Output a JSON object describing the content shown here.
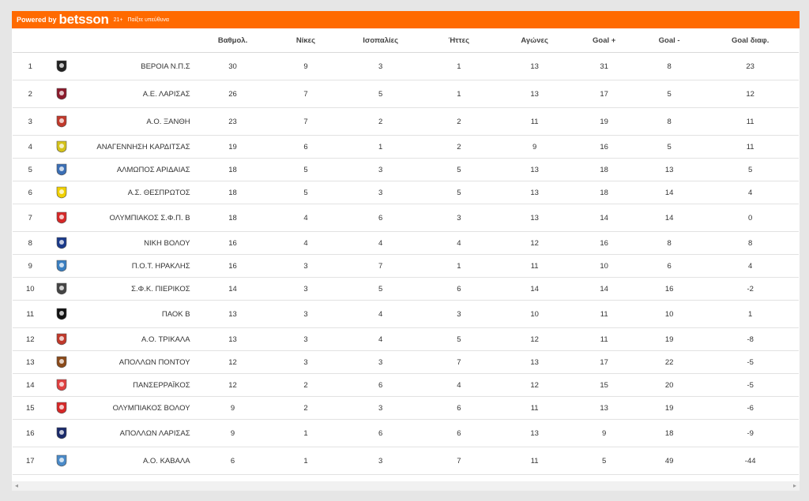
{
  "header": {
    "powered_by": "Powered by",
    "brand": "betsson",
    "age": "21+",
    "responsible": "Παίξτε υπεύθυνα"
  },
  "columns": [
    "Βαθμολ.",
    "Νίκες",
    "Ισοπαλίες",
    "Ήττες",
    "Αγώνες",
    "Goal +",
    "Goal -",
    "Goal διαφ."
  ],
  "rows": [
    {
      "pos": "1",
      "team": "ΒΕΡΟΙΑ Ν.Π.Σ",
      "pts": "30",
      "w": "9",
      "d": "3",
      "l": "1",
      "gp": "13",
      "gf": "31",
      "ga": "8",
      "gd": "23",
      "crest": "#222222",
      "tall": true
    },
    {
      "pos": "2",
      "team": "Α.Ε. ΛΑΡΙΣΑΣ",
      "pts": "26",
      "w": "7",
      "d": "5",
      "l": "1",
      "gp": "13",
      "gf": "17",
      "ga": "5",
      "gd": "12",
      "crest": "#8b1a2b",
      "tall": true
    },
    {
      "pos": "3",
      "team": "Α.Ο. ΞΑΝΘΗ",
      "pts": "23",
      "w": "7",
      "d": "2",
      "l": "2",
      "gp": "11",
      "gf": "19",
      "ga": "8",
      "gd": "11",
      "crest": "#c0392b",
      "tall": true
    },
    {
      "pos": "4",
      "team": "ΑΝΑΓΕΝΝΗΣΗ ΚΑΡΔΙΤΣΑΣ",
      "pts": "19",
      "w": "6",
      "d": "1",
      "l": "2",
      "gp": "9",
      "gf": "16",
      "ga": "5",
      "gd": "11",
      "crest": "#d4c21a",
      "tall": false
    },
    {
      "pos": "5",
      "team": "ΑΛΜΩΠΟΣ ΑΡΙΔΑΙΑΣ",
      "pts": "18",
      "w": "5",
      "d": "3",
      "l": "5",
      "gp": "13",
      "gf": "18",
      "ga": "13",
      "gd": "5",
      "crest": "#3b6fb5",
      "tall": false
    },
    {
      "pos": "6",
      "team": "Α.Σ. ΘΕΣΠΡΩΤΟΣ",
      "pts": "18",
      "w": "5",
      "d": "3",
      "l": "5",
      "gp": "13",
      "gf": "18",
      "ga": "14",
      "gd": "4",
      "crest": "#f0d000",
      "tall": false
    },
    {
      "pos": "7",
      "team": "ΟΛΥΜΠΙΑΚΟΣ Σ.Φ.Π. Β",
      "pts": "18",
      "w": "4",
      "d": "6",
      "l": "3",
      "gp": "13",
      "gf": "14",
      "ga": "14",
      "gd": "0",
      "crest": "#d62828",
      "tall": true
    },
    {
      "pos": "8",
      "team": "ΝΙΚΗ ΒΟΛΟΥ",
      "pts": "16",
      "w": "4",
      "d": "4",
      "l": "4",
      "gp": "12",
      "gf": "16",
      "ga": "8",
      "gd": "8",
      "crest": "#1a3a8a",
      "tall": false
    },
    {
      "pos": "9",
      "team": "Π.Ο.Τ. ΗΡΑΚΛΗΣ",
      "pts": "16",
      "w": "3",
      "d": "7",
      "l": "1",
      "gp": "11",
      "gf": "10",
      "ga": "6",
      "gd": "4",
      "crest": "#3a7fc1",
      "tall": false
    },
    {
      "pos": "10",
      "team": "Σ.Φ.Κ. ΠΙΕΡΙΚΟΣ",
      "pts": "14",
      "w": "3",
      "d": "5",
      "l": "6",
      "gp": "14",
      "gf": "14",
      "ga": "16",
      "gd": "-2",
      "crest": "#444444",
      "tall": false
    },
    {
      "pos": "11",
      "team": "ΠΑΟΚ Β",
      "pts": "13",
      "w": "3",
      "d": "4",
      "l": "3",
      "gp": "10",
      "gf": "11",
      "ga": "10",
      "gd": "1",
      "crest": "#111111",
      "tall": true
    },
    {
      "pos": "12",
      "team": "Α.Ο. ΤΡΙΚΑΛΑ",
      "pts": "13",
      "w": "3",
      "d": "4",
      "l": "5",
      "gp": "12",
      "gf": "11",
      "ga": "19",
      "gd": "-8",
      "crest": "#c0392b",
      "tall": false
    },
    {
      "pos": "13",
      "team": "ΑΠΟΛΛΩΝ ΠΟΝΤΟΥ",
      "pts": "12",
      "w": "3",
      "d": "3",
      "l": "7",
      "gp": "13",
      "gf": "17",
      "ga": "22",
      "gd": "-5",
      "crest": "#8a4a1a",
      "tall": false
    },
    {
      "pos": "14",
      "team": "ΠΑΝΣΕΡΡΑΪΚΟΣ",
      "pts": "12",
      "w": "2",
      "d": "6",
      "l": "4",
      "gp": "12",
      "gf": "15",
      "ga": "20",
      "gd": "-5",
      "crest": "#e04040",
      "tall": false
    },
    {
      "pos": "15",
      "team": "ΟΛΥΜΠΙΑΚΟΣ ΒΟΛΟΥ",
      "pts": "9",
      "w": "2",
      "d": "3",
      "l": "6",
      "gp": "11",
      "gf": "13",
      "ga": "19",
      "gd": "-6",
      "crest": "#d62828",
      "tall": false
    },
    {
      "pos": "16",
      "team": "ΑΠΟΛΛΩΝ ΛΑΡΙΣΑΣ",
      "pts": "9",
      "w": "1",
      "d": "6",
      "l": "6",
      "gp": "13",
      "gf": "9",
      "ga": "18",
      "gd": "-9",
      "crest": "#1a2a6a",
      "tall": true
    },
    {
      "pos": "17",
      "team": "Α.Ο. ΚΑΒΑΛΑ",
      "pts": "6",
      "w": "1",
      "d": "3",
      "l": "7",
      "gp": "11",
      "gf": "5",
      "ga": "49",
      "gd": "-44",
      "crest": "#4a8ac8",
      "tall": true
    }
  ],
  "scrollbar": {
    "left_arrow": "◂",
    "right_arrow": "▸"
  }
}
